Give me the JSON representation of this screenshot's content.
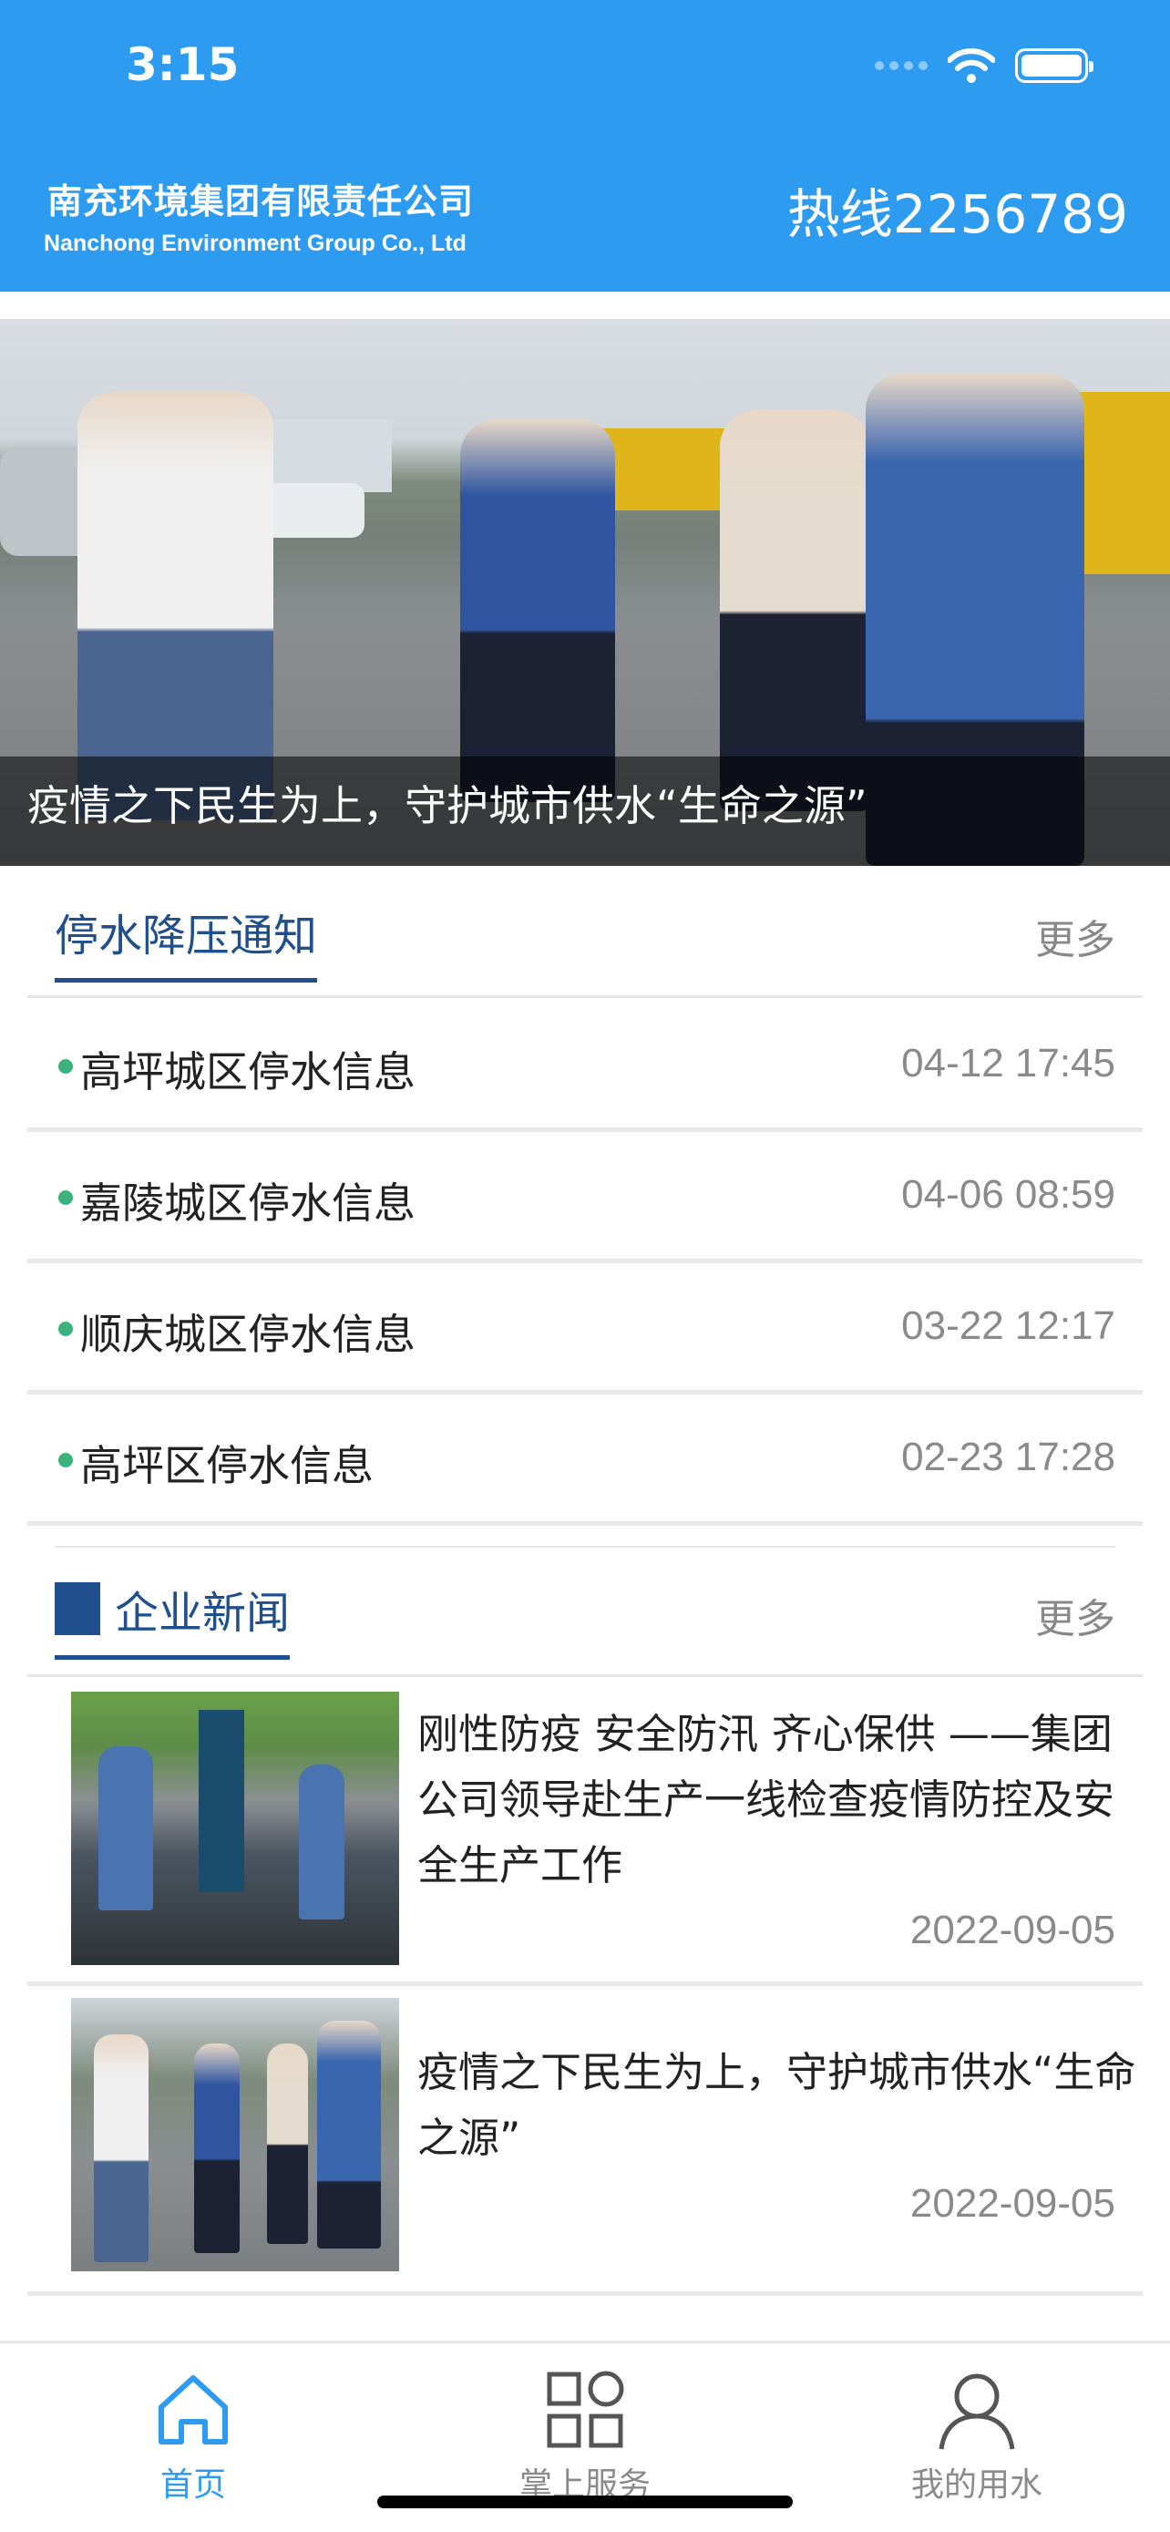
{
  "status_bar": {
    "time": "3:15"
  },
  "header": {
    "company_cn": "南充环境集团有限责任公司",
    "company_en": "Nanchong Environment Group Co., Ltd",
    "hotline": "热线2256789",
    "bg_color": "#2d9cf0"
  },
  "banner": {
    "caption": "疫情之下民生为上，守护城市供水“生命之源”"
  },
  "notices": {
    "title": "停水降压通知",
    "more": "更多",
    "items": [
      {
        "title": "高坪城区停水信息",
        "time": "04-12 17:45"
      },
      {
        "title": "嘉陵城区停水信息",
        "time": "04-06 08:59"
      },
      {
        "title": "顺庆城区停水信息",
        "time": "03-22 12:17"
      },
      {
        "title": "高坪区停水信息",
        "time": "02-23 17:28"
      }
    ]
  },
  "news": {
    "title": "企业新闻",
    "more": "更多",
    "items": [
      {
        "title": "刚性防疫 安全防汛 齐心保供 ——集团公司领导赴生产一线检查疫情防控及安全生产工作",
        "date": "2022-09-05"
      },
      {
        "title": "疫情之下民生为上，守护城市供水“生命之源”",
        "date": "2022-09-05"
      }
    ]
  },
  "tabbar": {
    "items": [
      {
        "label": "首页",
        "icon": "home-icon",
        "active": true
      },
      {
        "label": "掌上服务",
        "icon": "grid-icon",
        "active": false
      },
      {
        "label": "我的用水",
        "icon": "user-icon",
        "active": false
      }
    ],
    "active_color": "#2d9cf0"
  }
}
